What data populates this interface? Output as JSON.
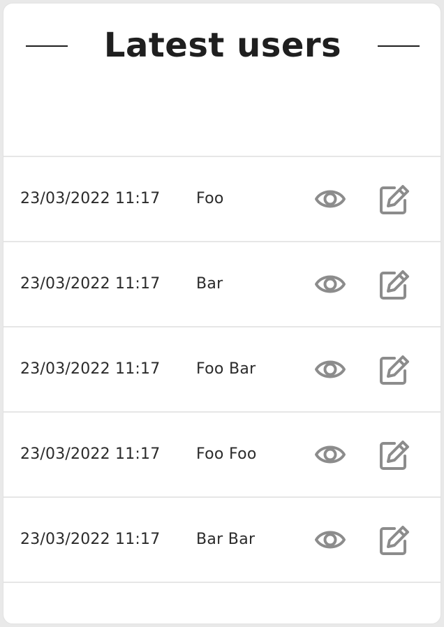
{
  "card": {
    "title": "Latest users"
  },
  "users": [
    {
      "date": "23/03/2022 11:17",
      "name": "Foo"
    },
    {
      "date": "23/03/2022 11:17",
      "name": "Bar"
    },
    {
      "date": "23/03/2022 11:17",
      "name": "Foo Bar"
    },
    {
      "date": "23/03/2022 11:17",
      "name": "Foo Foo"
    },
    {
      "date": "23/03/2022 11:17",
      "name": "Bar Bar"
    }
  ],
  "icons": {
    "view": "eye-icon",
    "edit": "edit-icon"
  },
  "colors": {
    "icon": "#8c8c8c",
    "title": "#1f1f1f",
    "divider": "#e6e6e6"
  }
}
